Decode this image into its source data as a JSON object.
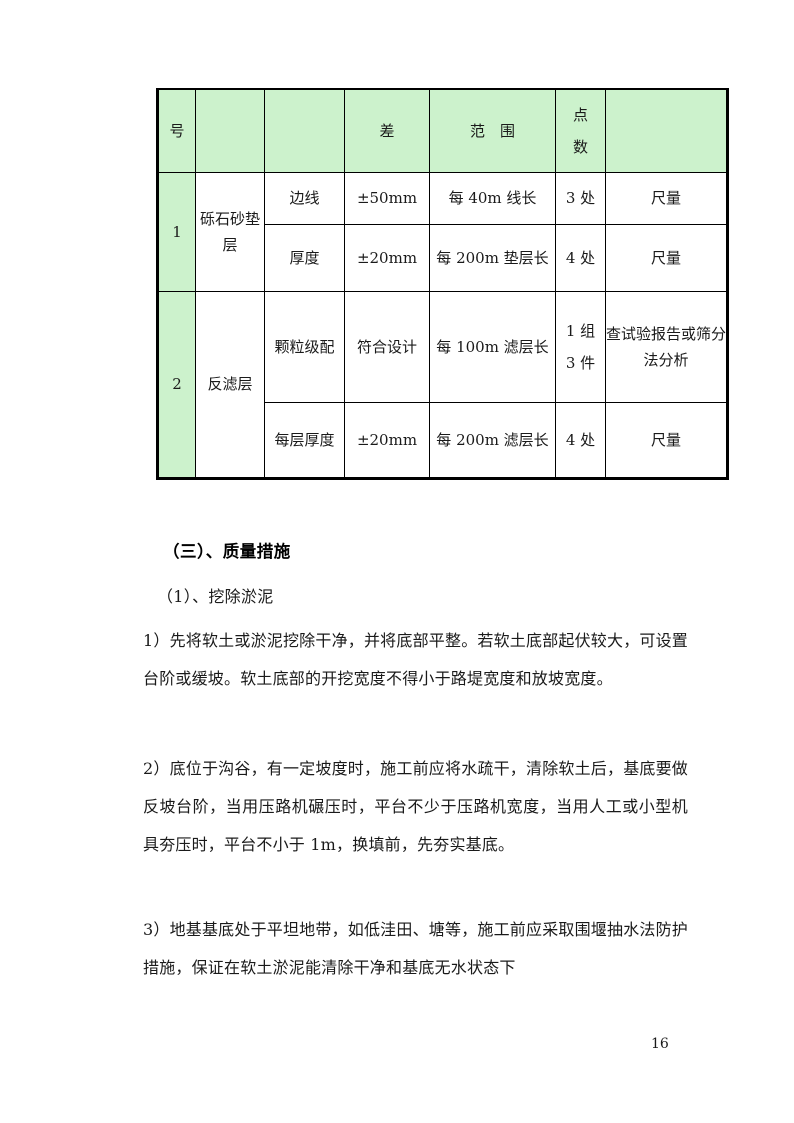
{
  "document": {
    "page_number": "16",
    "accent_shade_color": "#ccf2cc",
    "text_color": "#1a1a1a"
  },
  "table": {
    "header": {
      "col0": "号",
      "col1": "",
      "col2": "",
      "col3": "差",
      "col4": "范　围",
      "col5": "点\n数",
      "col5_line1": "点",
      "col5_line2": "数",
      "col6": ""
    },
    "rows": [
      {
        "no": "1",
        "item": "砾石砂垫层",
        "subrows": [
          {
            "check_item": "边线",
            "tolerance": "±50mm",
            "scope": "每 40m 线长",
            "points": "3 处",
            "method": "尺量"
          },
          {
            "check_item": "厚度",
            "tolerance": "±20mm",
            "scope": "每 200m 垫层长",
            "points": "4 处",
            "method": "尺量"
          }
        ]
      },
      {
        "no": "2",
        "item": "反滤层",
        "subrows": [
          {
            "check_item": "颗粒级配",
            "tolerance": "符合设计",
            "scope": "每 100m 滤层长",
            "points": "1 组3 件",
            "points_line1": "1 组",
            "points_line2": "3 件",
            "method": "查试验报告或筛分法分析"
          },
          {
            "check_item": "每层厚度",
            "tolerance": "±20mm",
            "scope": "每 200m 滤层长",
            "points": "4 处",
            "method": "尺量"
          }
        ]
      }
    ]
  },
  "body": {
    "heading": "（三）、质量措施",
    "subheading": "（1）、挖除淤泥",
    "paragraphs": [
      "1）先将软土或淤泥挖除干净，并将底部平整。若软土底部起伏较大，可设置台阶或缓坡。软土底部的开挖宽度不得小于路堤宽度和放坡宽度。",
      "2）底位于沟谷，有一定坡度时，施工前应将水疏干，清除软土后，基底要做反坡台阶，当用压路机碾压时，平台不少于压路机宽度，当用人工或小型机具夯压时，平台不小于 1m，换填前，先夯实基底。",
      "3）地基基底处于平坦地带，如低洼田、塘等，施工前应采取围堰抽水法防护措施，保证在软土淤泥能清除干净和基底无水状态下"
    ]
  }
}
